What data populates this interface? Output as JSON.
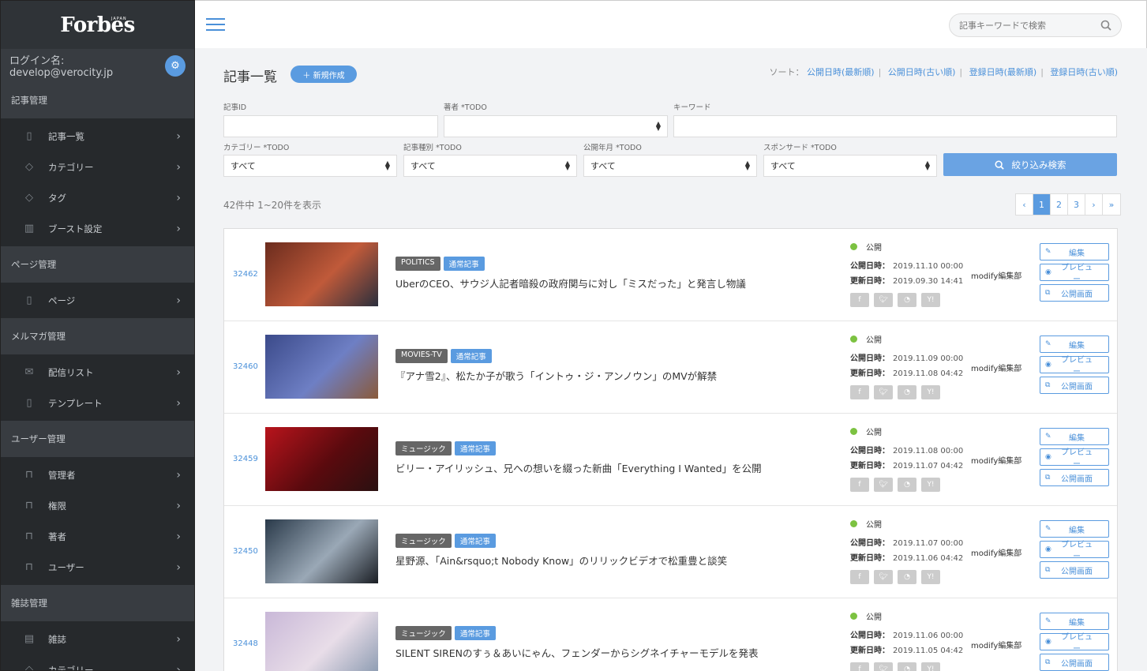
{
  "sidebar": {
    "logo": "Forbes",
    "logo_sub": "JAPAN",
    "user_label": "ログイン名: develop@verocity.jp",
    "sections": [
      {
        "title": "記事管理",
        "items": [
          {
            "label": "記事一覧",
            "icon": "document-icon"
          },
          {
            "label": "カテゴリー",
            "icon": "tag-icon"
          },
          {
            "label": "タグ",
            "icon": "tag-icon"
          },
          {
            "label": "ブースト設定",
            "icon": "bar-chart-icon"
          }
        ]
      },
      {
        "title": "ページ管理",
        "items": [
          {
            "label": "ページ",
            "icon": "document-icon"
          }
        ]
      },
      {
        "title": "メルマガ管理",
        "items": [
          {
            "label": "配信リスト",
            "icon": "envelope-icon"
          },
          {
            "label": "テンプレート",
            "icon": "document-icon"
          }
        ]
      },
      {
        "title": "ユーザー管理",
        "items": [
          {
            "label": "管理者",
            "icon": "lock-icon"
          },
          {
            "label": "権限",
            "icon": "lock-icon"
          },
          {
            "label": "著者",
            "icon": "lock-icon"
          },
          {
            "label": "ユーザー",
            "icon": "lock-icon"
          }
        ]
      },
      {
        "title": "雑誌管理",
        "items": [
          {
            "label": "雑誌",
            "icon": "book-icon"
          },
          {
            "label": "カテゴリー",
            "icon": "tag-icon"
          }
        ]
      }
    ]
  },
  "topbar": {
    "search_placeholder": "記事キーワードで検索"
  },
  "main": {
    "title": "記事一覧",
    "new_button": "＋ 新規作成",
    "sort_label": "ソート：",
    "sort_options": [
      "公開日時(最新順)",
      "公開日時(古い順)",
      "登録日時(最新順)",
      "登録日時(古い順)"
    ],
    "filters": {
      "article_id_label": "記事ID",
      "author_label": "著者 *TODO",
      "keyword_label": "キーワード",
      "category_label": "カテゴリー *TODO",
      "category_value": "すべて",
      "kind_label": "記事種別 *TODO",
      "kind_value": "すべて",
      "pub_month_label": "公開年月 *TODO",
      "pub_month_value": "すべて",
      "sponsor_label": "スポンサード *TODO",
      "sponsor_value": "すべて",
      "search_button": "絞り込み検索"
    },
    "count_text": "42件中 1~20件を表示",
    "pagination": [
      "‹",
      "1",
      "2",
      "3",
      "›",
      "»"
    ],
    "pagination_active": "1",
    "status_text": "公開",
    "pub_label": "公開日時：",
    "upd_label": "更新日時：",
    "social": [
      "f",
      "t",
      "rss",
      "Y!"
    ],
    "actions": {
      "edit": "編集",
      "preview": "プレビュー",
      "public": "公開画面"
    },
    "articles": [
      {
        "id": "32462",
        "category": "POLITICS",
        "kind": "通常記事",
        "title": "UberのCEO、サウジ人記者暗殺の政府関与に対し「ミスだった」と発言し物議",
        "published": "2019.11.10 00:00",
        "updated": "2019.09.30 14:41",
        "editor": "modify編集部",
        "thumb_colors": [
          "#6b2c1e",
          "#c05a3a",
          "#2a2f3d"
        ]
      },
      {
        "id": "32460",
        "category": "MOVIES-TV",
        "kind": "通常記事",
        "title": "『アナ雪2』、松たか子が歌う「イントゥ・ジ・アンノウン」のMVが解禁",
        "published": "2019.11.09 00:00",
        "updated": "2019.11.08 04:42",
        "editor": "modify編集部",
        "thumb_colors": [
          "#3b4a8a",
          "#6e7fc4",
          "#8a5a3a"
        ]
      },
      {
        "id": "32459",
        "category": "ミュージック",
        "kind": "通常記事",
        "title": "ビリー・アイリッシュ、兄への想いを綴った新曲「Everything I Wanted」を公開",
        "published": "2019.11.08 00:00",
        "updated": "2019.11.07 04:42",
        "editor": "modify編集部",
        "thumb_colors": [
          "#b8141c",
          "#5a0a0e",
          "#2a1010"
        ]
      },
      {
        "id": "32450",
        "category": "ミュージック",
        "kind": "通常記事",
        "title": "星野源、「Ain&rsquo;t Nobody Know」のリリックビデオで松重豊と談笑",
        "published": "2019.11.07 00:00",
        "updated": "2019.11.06 04:42",
        "editor": "modify編集部",
        "thumb_colors": [
          "#2a3a4a",
          "#9aa8b6",
          "#1a1e24"
        ]
      },
      {
        "id": "32448",
        "category": "ミュージック",
        "kind": "通常記事",
        "title": "SILENT SIRENのすぅ＆あいにゃん、フェンダーからシグネイチャーモデルを発表",
        "published": "2019.11.06 00:00",
        "updated": "2019.11.05 04:42",
        "editor": "modify編集部",
        "thumb_colors": [
          "#c9b8d8",
          "#e8dde8",
          "#8a9ab0"
        ]
      }
    ]
  }
}
